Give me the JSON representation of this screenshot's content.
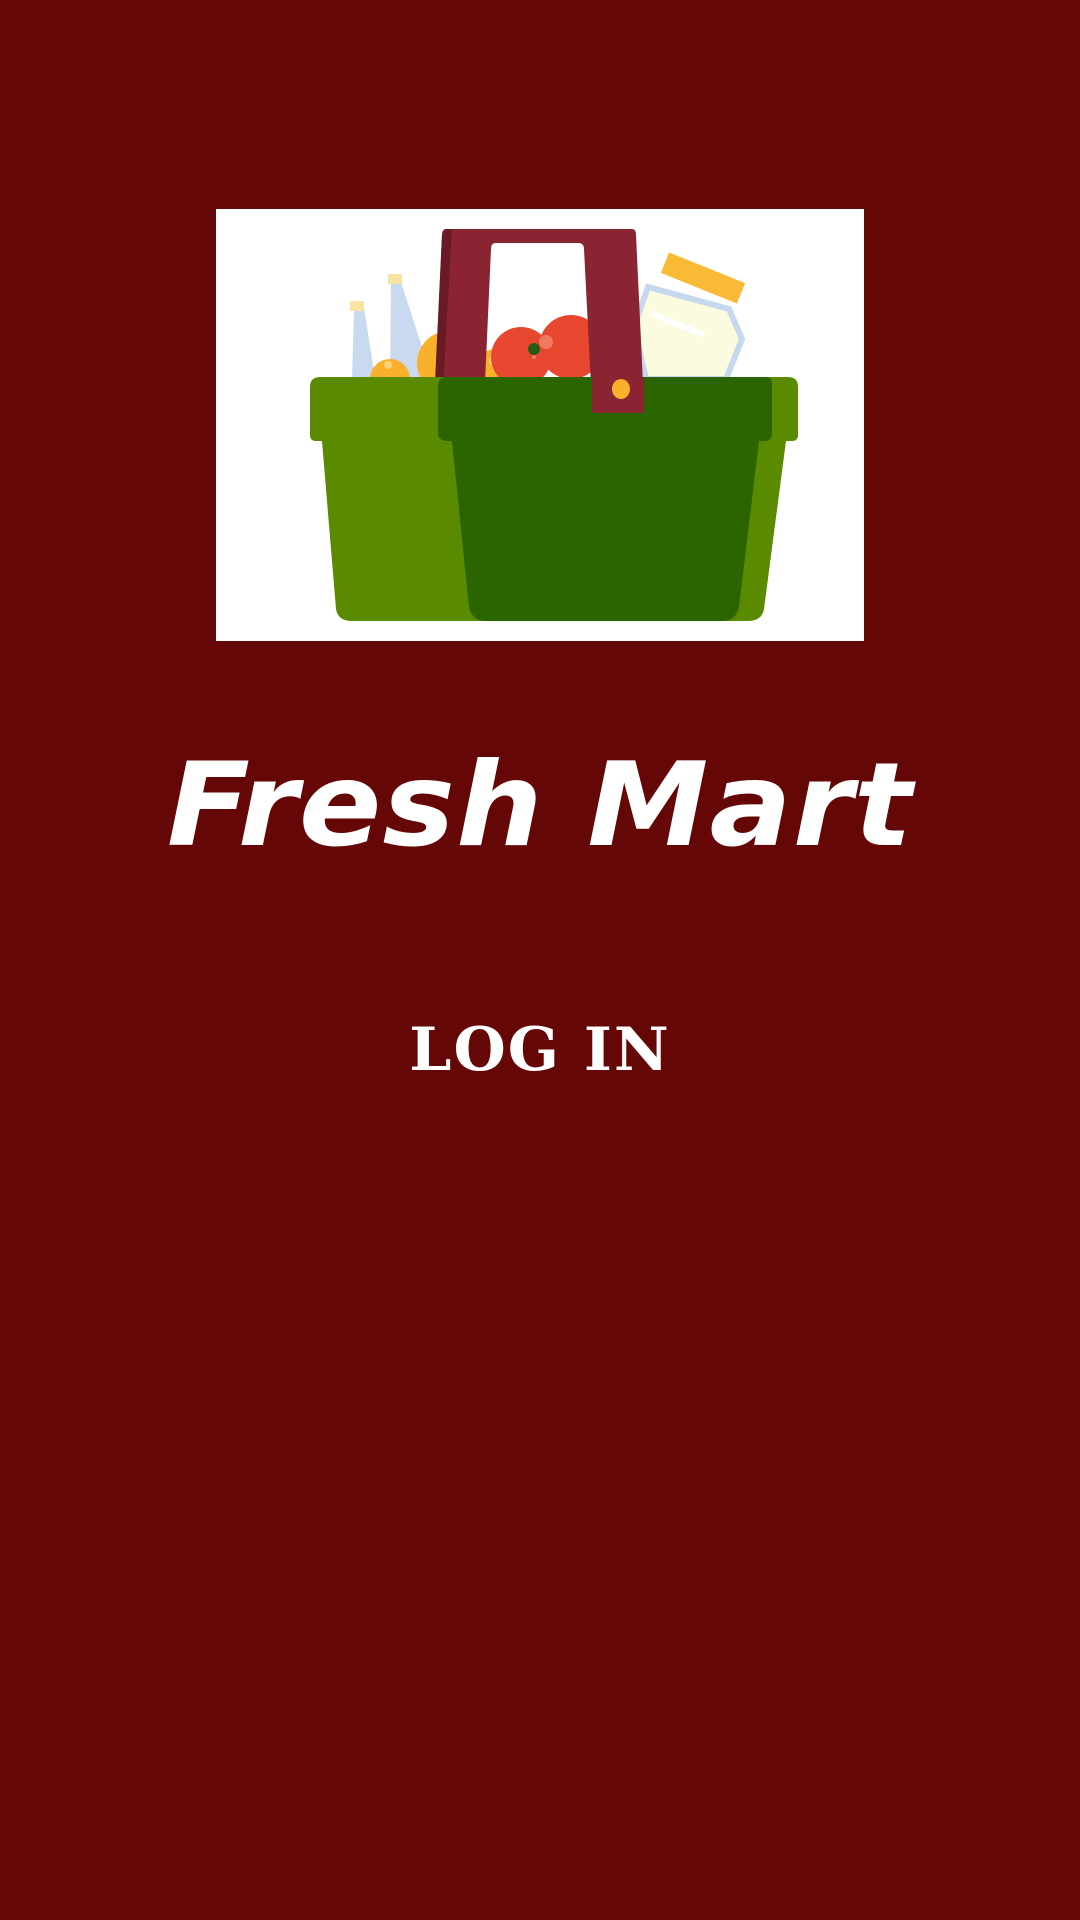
{
  "app": {
    "title": "Fresh Mart"
  },
  "logo": {
    "icon": "grocery-basket-icon"
  },
  "login": {
    "label": "LOG IN"
  },
  "colors": {
    "background": "#650607",
    "text": "#ffffff",
    "basket_dark_green": "#2a6500",
    "basket_light_green": "#5a8a00",
    "handle": "#8a2432"
  }
}
